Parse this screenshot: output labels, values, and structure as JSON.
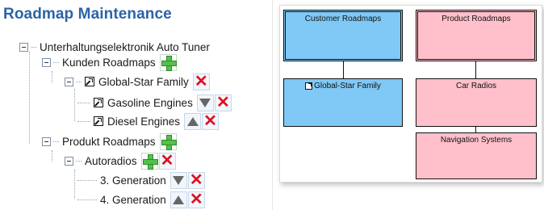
{
  "title": "Roadmap Maintenance",
  "tree": {
    "root": "Unterhaltungselektronik Auto Tuner",
    "kunden": "Kunden Roadmaps",
    "global_star": "Global-Star Family",
    "gasoline": "Gasoline Engines",
    "diesel": "Diesel Engines",
    "produkt": "Produkt Roadmaps",
    "autoradios": "Autoradios",
    "gen3": "3. Generation",
    "gen4": "4. Generation"
  },
  "diagram": {
    "customer_roadmaps": "Customer Roadmaps",
    "global_star_family": "Global-Star Family",
    "product_roadmaps": "Product Roadmaps",
    "car_radios": "Car Radios",
    "navigation_systems": "Navigation Systems"
  },
  "colors": {
    "title": "#2b64a6",
    "customer_node": "#80c8f5",
    "product_node": "#ffc0cb",
    "add_icon": "#54c04b",
    "delete_icon": "#e01020"
  },
  "icons": {
    "expand": "minus-box-icon",
    "add": "plus-icon",
    "delete": "x-icon",
    "move_down": "triangle-down-icon",
    "move_up": "triangle-up-icon",
    "link": "shortcut-arrow-icon"
  }
}
